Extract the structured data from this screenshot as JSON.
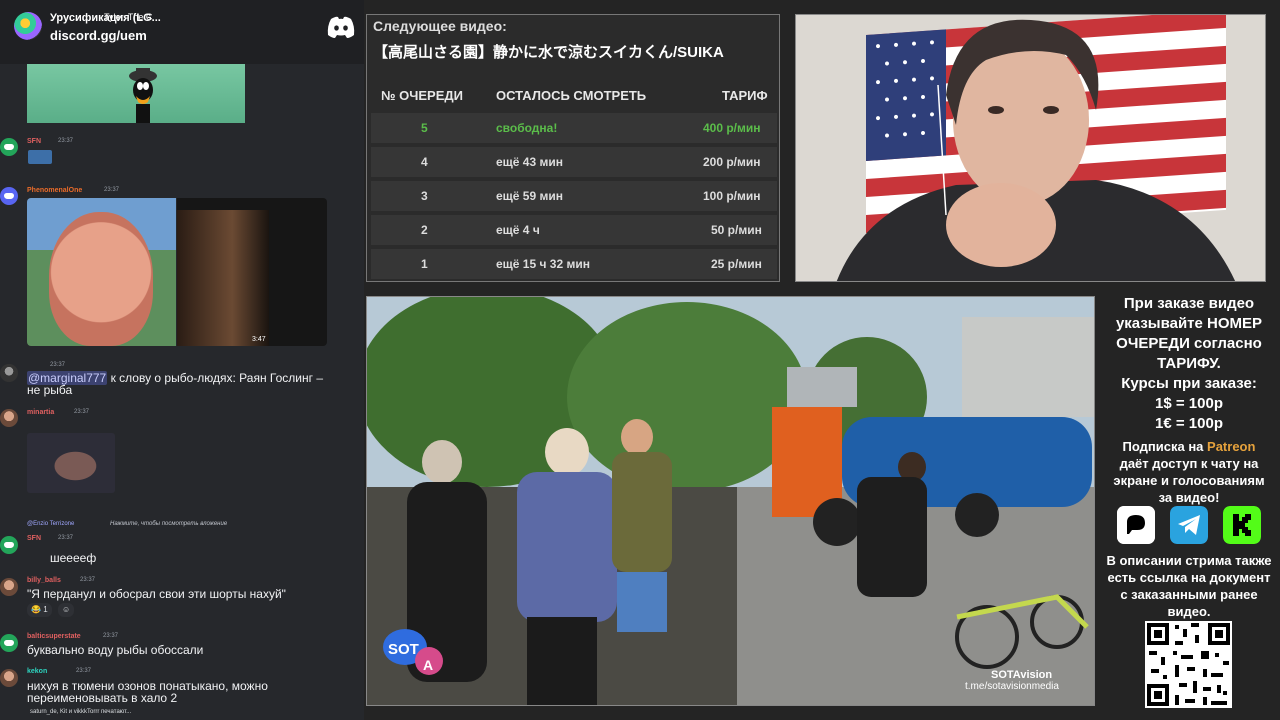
{
  "chat": {
    "server_name": "Урусификация (LG...",
    "invite": "discord.gg/uem",
    "messages": [
      {
        "user": "SFN",
        "time": "23:37"
      },
      {
        "user": "PhenomenalOne",
        "time": "23:37"
      },
      {
        "user": "",
        "time": "23:37",
        "mention": "@marginal777",
        "text": "к слову о рыбо-людях: Раян Гослинг –",
        "text2": "не рыба"
      },
      {
        "user": "minartia",
        "time": "23:37"
      },
      {
        "reply": "@Enzio Terrizone",
        "reply_text": "Нажмите, чтобы посмотреть вложение"
      },
      {
        "user": "SFN",
        "time": "23:37",
        "text": "шееееф"
      },
      {
        "user": "billy_balls",
        "time": "23:37",
        "text": "\"Я перданул и обосрал свои эти шорты нахуй\"",
        "reaction_count": "1"
      },
      {
        "user": "balticsuperstate",
        "time": "23:37",
        "text": "буквально воду рыбы обоссали"
      },
      {
        "user": "kekon",
        "time": "23:37",
        "text": "нихуя в тюмени озонов понатыкано, можно",
        "text2": "переименовывать в халo 2"
      }
    ],
    "video_embed": {
      "title": "Tyler, The C",
      "duration": "3:47"
    },
    "typing": "saturn_de, Kit и vikkkTorrr печатают..."
  },
  "queue": {
    "label": "Следующее видео:",
    "title": "【高尾山さる園】静かに水で涼むスイカくん/SUIKA",
    "headers": [
      "№ ОЧЕРЕДИ",
      "ОСТАЛОСЬ СМОТРЕТЬ",
      "ТАРИФ"
    ],
    "rows": [
      {
        "n": "5",
        "left": "свободна!",
        "rate": "400 р/мин",
        "free": true
      },
      {
        "n": "4",
        "left": "ещё 43 мин",
        "rate": "200 р/мин"
      },
      {
        "n": "3",
        "left": "ещё 59 мин",
        "rate": "100 р/мин"
      },
      {
        "n": "2",
        "left": "ещё 4 ч",
        "rate": "50 р/мин"
      },
      {
        "n": "1",
        "left": "ещё 15 ч 32 мин",
        "rate": "25 р/мин"
      }
    ]
  },
  "video": {
    "badge": "SOT",
    "badge_letter": "A",
    "watermark": "SOTAvision",
    "watermark_link": "t.me/sotavisionmedia"
  },
  "info": {
    "line1": "При заказе видео",
    "line2": "указывайте НОМЕР",
    "line3": "ОЧЕРЕДИ согласно",
    "line4": "ТАРИФУ.",
    "line5": "Курсы при заказе:",
    "line6": "1$ = 100р",
    "line7": "1€ = 100р",
    "sub1_pre": "Подписка на ",
    "sub1_brand": "Patreon",
    "sub2": "даёт доступ к чату на",
    "sub3": "экране и голосованиям",
    "sub4": "за видео!",
    "desc1": "В описании стрима также",
    "desc2": "есть ссылка на документ",
    "desc3": "с заказанными ранее",
    "desc4": "видео."
  },
  "colors": {
    "free": "#5bbd4a",
    "patreon": "#e6a23c",
    "telegram": "#2aa3df",
    "kick": "#53fc18"
  }
}
